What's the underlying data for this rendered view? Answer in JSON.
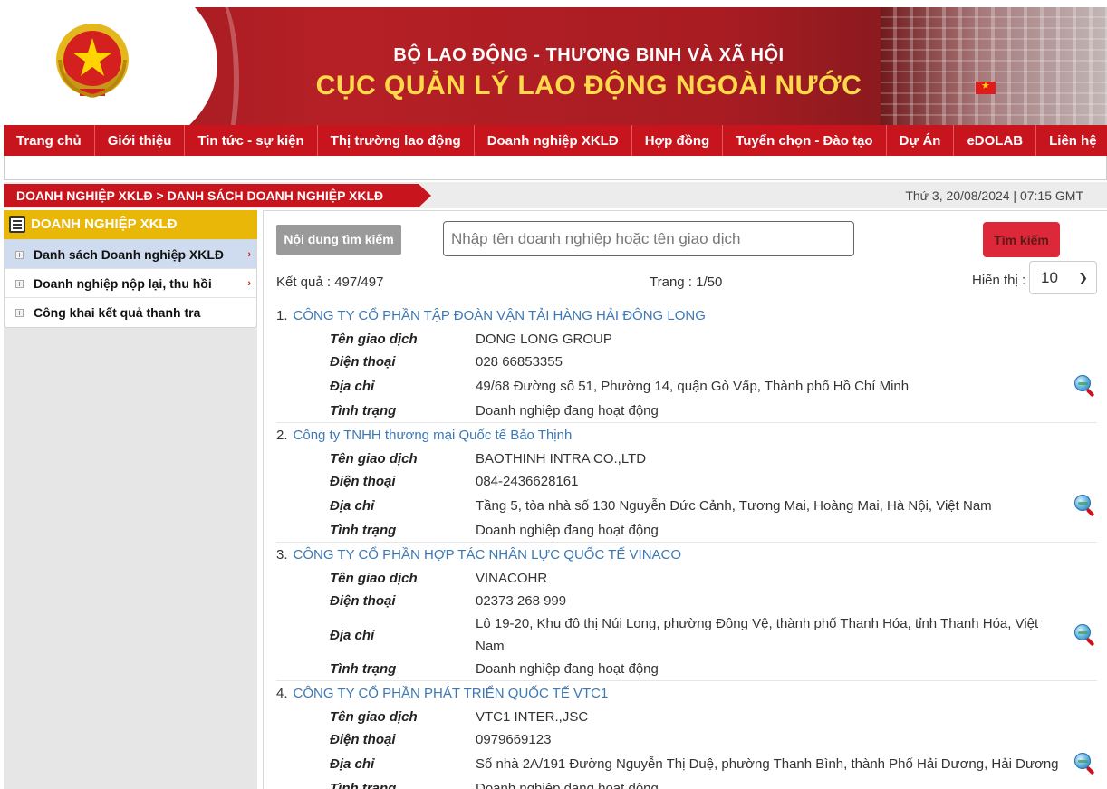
{
  "header": {
    "ministry": "BỘ LAO ĐỘNG - THƯƠNG BINH VÀ XÃ HỘI",
    "department": "CỤC QUẢN LÝ LAO ĐỘNG NGOÀI NƯỚC",
    "emblem_icon": "vietnam-national-emblem-icon",
    "colors": {
      "banner_red": "#b52026",
      "nav_red": "#c8151d",
      "title_yellow": "#ffd94a"
    }
  },
  "nav": {
    "items": [
      {
        "label": "Trang chủ"
      },
      {
        "label": "Giới thiệu"
      },
      {
        "label": "Tin tức - sự kiện"
      },
      {
        "label": "Thị trường lao động"
      },
      {
        "label": "Doanh nghiệp XKLĐ"
      },
      {
        "label": "Hợp đồng"
      },
      {
        "label": "Tuyển chọn - Đào tạo"
      },
      {
        "label": "Dự Án"
      },
      {
        "label": "eDOLAB"
      },
      {
        "label": "Liên hệ"
      }
    ]
  },
  "breadcrumb": {
    "section": "DOANH NGHIỆP XKLĐ",
    "separator": " > ",
    "page": "DANH SÁCH DOANH NGHIỆP XKLĐ"
  },
  "datetime": "Thứ 3, 20/08/2024 | 07:15 GMT",
  "sidebar": {
    "title": "DOANH NGHIỆP XKLĐ",
    "title_icon": "list-icon",
    "accent": "#e8b708",
    "items": [
      {
        "label": "Danh sách Doanh nghiệp XKLĐ",
        "arrow": "›",
        "active": true
      },
      {
        "label": "Doanh nghiệp nộp lại, thu hồi",
        "arrow": "›"
      },
      {
        "label": "Công khai kết quả thanh tra",
        "arrow": ""
      }
    ]
  },
  "search": {
    "label": "Nội dung tìm kiếm",
    "placeholder": "Nhập tên doanh nghiệp hoặc tên giao dịch",
    "button": "Tìm kiếm"
  },
  "summary": {
    "result": "Kết quả : 497/497",
    "page": "Trang : 1/50",
    "show_label": "Hiển thị :",
    "show_value": "10"
  },
  "field_labels": {
    "trade_name": "Tên giao dịch",
    "phone": "Điện thoại",
    "address": "Địa chỉ",
    "status": "Tình trạng"
  },
  "companies": [
    {
      "index": "1.",
      "name": "CÔNG TY CỔ PHẦN TẬP ĐOÀN VẬN TẢI HÀNG HẢI ĐÔNG LONG",
      "trade_name": "DONG LONG GROUP",
      "phone": "028 66853355",
      "address": "49/68 Đường số 51, Phường 14, quận Gò Vấp, Thành phố Hồ Chí Minh",
      "status": "Doanh nghiệp đang hoạt động"
    },
    {
      "index": "2.",
      "name": "Công ty TNHH thương mại Quốc tế Bảo Thịnh",
      "trade_name": "BAOTHINH INTRA CO.,LTD",
      "phone": "084-2436628161",
      "address": "Tầng 5, tòa nhà số 130 Nguyễn Đức Cảnh, Tương Mai, Hoàng Mai, Hà Nội, Việt Nam",
      "status": "Doanh nghiệp đang hoạt động"
    },
    {
      "index": "3.",
      "name": "CÔNG TY CỔ PHẦN HỢP TÁC NHÂN LỰC QUỐC TẾ VINACO",
      "trade_name": "VINACOHR",
      "phone": "02373 268 999",
      "address": "Lô 19-20, Khu đô thị Núi Long, phường Đông Vệ, thành phố Thanh Hóa, tỉnh Thanh Hóa, Việt Nam",
      "status": "Doanh nghiệp đang hoạt động"
    },
    {
      "index": "4.",
      "name": "CÔNG TY CỔ PHẦN PHÁT TRIỂN QUỐC TẾ VTC1",
      "trade_name": "VTC1 INTER.,JSC",
      "phone": "0979669123",
      "address": "Số nhà 2A/191 Đường Nguyễn Thị Duệ, phường Thanh Bình, thành Phố Hải Dương, Hải Dương",
      "status": "Doanh nghiệp đang hoạt động"
    }
  ],
  "lookup_icon": "globe-search-icon"
}
